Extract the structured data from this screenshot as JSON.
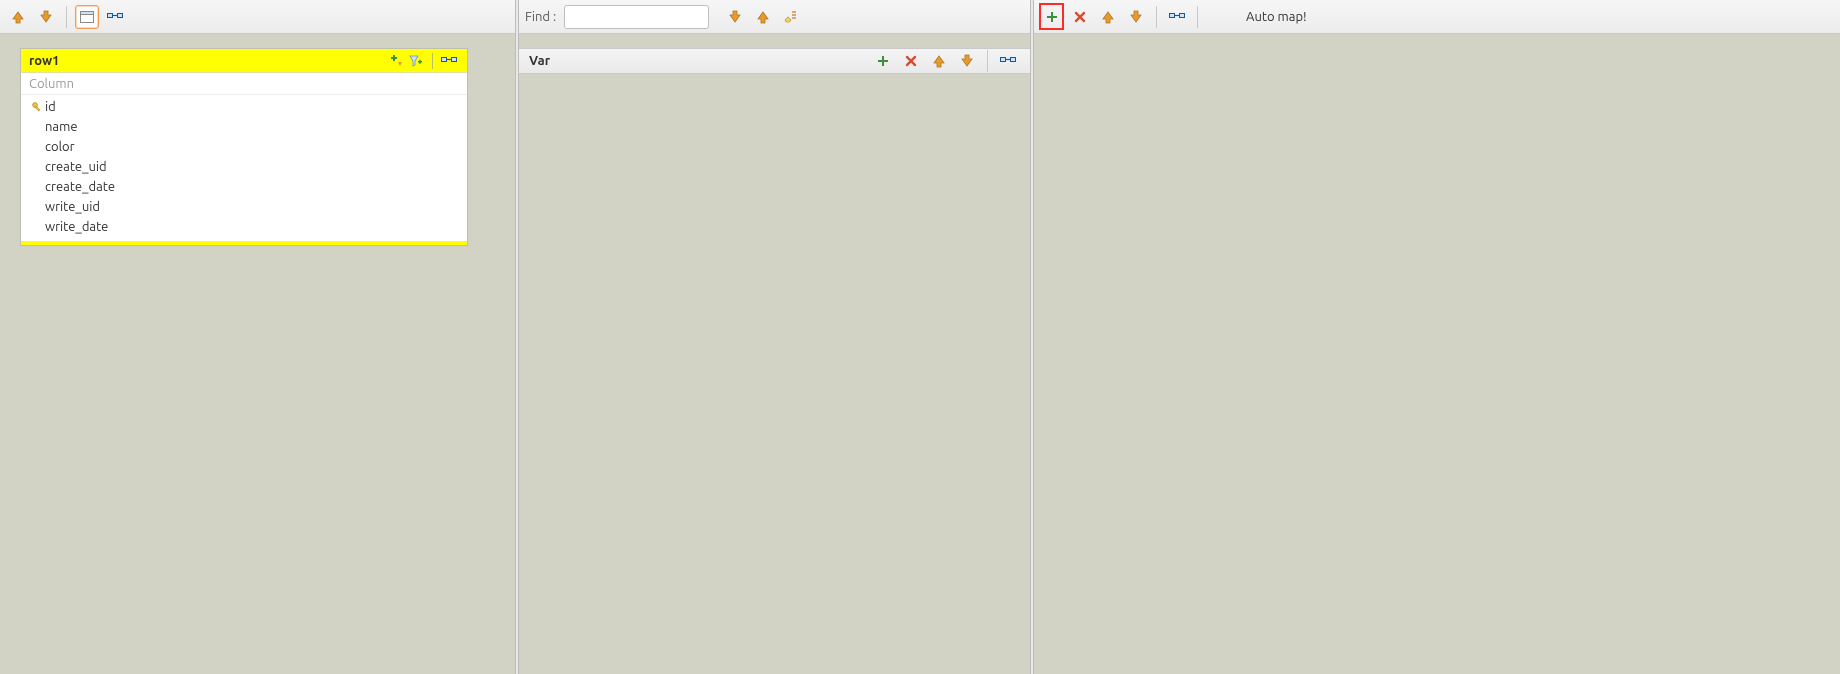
{
  "left": {
    "row": {
      "title": "row1",
      "subheader": "Column",
      "columns": [
        {
          "name": "id",
          "is_key": true
        },
        {
          "name": "name",
          "is_key": false
        },
        {
          "name": "color",
          "is_key": false
        },
        {
          "name": "create_uid",
          "is_key": false
        },
        {
          "name": "create_date",
          "is_key": false
        },
        {
          "name": "write_uid",
          "is_key": false
        },
        {
          "name": "write_date",
          "is_key": false
        }
      ]
    }
  },
  "middle": {
    "find_label": "Find :",
    "find_value": "",
    "var_label": "Var"
  },
  "right": {
    "automap_label": "Auto map!"
  },
  "colors": {
    "highlight": "#ffff00",
    "add": "#3c8f3c",
    "remove": "#d84b2f",
    "arrow": "#e79b2d"
  }
}
